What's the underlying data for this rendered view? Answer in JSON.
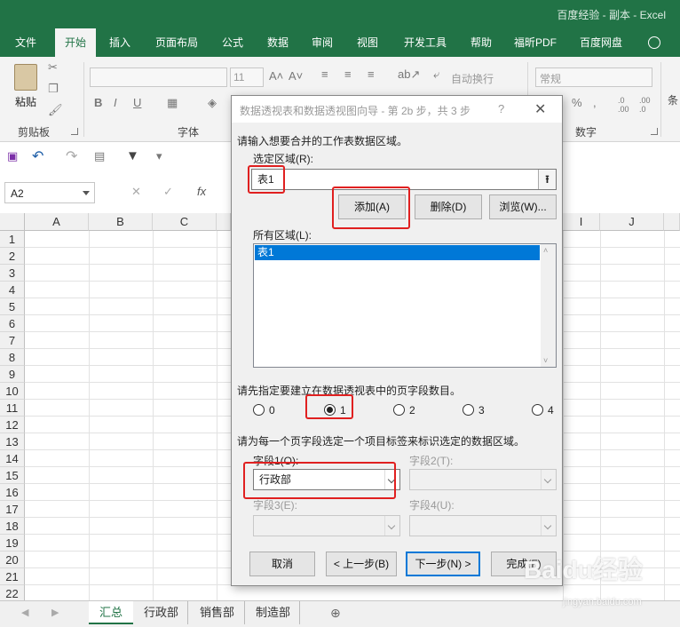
{
  "window": {
    "title": "百度经验 - 副本 - Excel"
  },
  "ribbon_tabs": [
    "文件",
    "开始",
    "插入",
    "页面布局",
    "公式",
    "数据",
    "审阅",
    "视图",
    "开发工具",
    "帮助",
    "福昕PDF",
    "百度网盘"
  ],
  "ribbon": {
    "paste_label": "粘贴",
    "clipboard_label": "剪贴板",
    "font_label": "字体",
    "font_size": "11",
    "wrap_text": "自动换行",
    "number_format": "常规",
    "number_label": "数字",
    "conditional_partial": "条"
  },
  "formula_bar": {
    "name_box": "A2",
    "fx": "fx"
  },
  "grid": {
    "columns": [
      "A",
      "B",
      "C",
      "I",
      "J"
    ],
    "rows": [
      "1",
      "2",
      "3",
      "4",
      "5",
      "6",
      "7",
      "8",
      "9",
      "10",
      "11",
      "12",
      "13",
      "14",
      "15",
      "16",
      "17",
      "18",
      "19",
      "20",
      "21",
      "22"
    ]
  },
  "sheets": [
    "汇总",
    "行政部",
    "销售部",
    "制造部"
  ],
  "dialog": {
    "title": "数据透视表和数据透视图向导 - 第 2b 步，共 3 步",
    "help": "?",
    "close": "✕",
    "prompt_range": "请输入想要合并的工作表数据区域。",
    "selected_range_label": "选定区域(R):",
    "selected_range_value": "表1",
    "add_button": "添加(A)",
    "delete_button": "删除(D)",
    "browse_button": "浏览(W)...",
    "all_ranges_label": "所有区域(L):",
    "all_ranges_items": [
      "表1"
    ],
    "page_fields_prompt": "请先指定要建立在数据透视表中的页字段数目。",
    "radio_options": [
      "0",
      "1",
      "2",
      "3",
      "4"
    ],
    "radio_selected": "1",
    "item_label_prompt": "请为每一个页字段选定一个项目标签来标识选定的数据区域。",
    "field1_label": "字段1(O):",
    "field1_value": "行政部",
    "field2_label": "字段2(T):",
    "field3_label": "字段3(E):",
    "field4_label": "字段4(U):",
    "cancel_button": "取消",
    "back_button": "< 上一步(B)",
    "next_button": "下一步(N) >",
    "finish_button": "完成(F)"
  },
  "watermark": {
    "brand": "Baidu经验",
    "url": "jingyan.baidu.com"
  },
  "colors": {
    "excel_green": "#217346",
    "highlight_red": "#e02020",
    "selection_blue": "#0078d7"
  }
}
